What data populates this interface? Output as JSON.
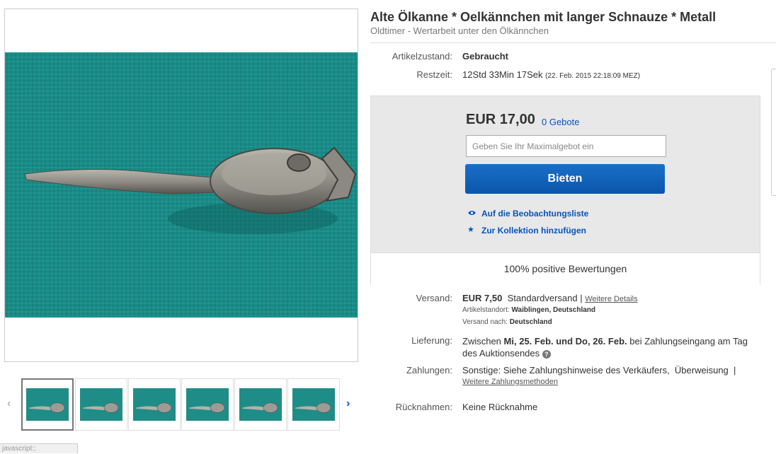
{
  "item": {
    "title": "Alte Ölkanne * Oelkännchen mit langer Schnauze * Metall",
    "subtitle": "Oldtimer - Wertarbeit unter den Ölkännchen"
  },
  "condition": {
    "label": "Artikelzustand:",
    "value": "Gebraucht"
  },
  "time_left": {
    "label": "Restzeit:",
    "value": "12Std 33Min 17Sek",
    "end": "(22. Feb. 2015   22:18:09 MEZ)"
  },
  "bid": {
    "price": "EUR 17,00",
    "bids": "0 Gebote",
    "placeholder": "Geben Sie Ihr Maximalgebot ein",
    "button": "Bieten",
    "watch": "Auf die Beobachtungsliste",
    "collection": "Zur Kollektion hinzufügen",
    "feedback": "100% positive Bewertungen"
  },
  "shipping": {
    "label": "Versand:",
    "price": "EUR 7,50",
    "service": "Standardversand |",
    "details_link": "Weitere Details",
    "location_label": "Artikelstandort:",
    "location": "Waiblingen, Deutschland",
    "ships_to_label": "Versand nach:",
    "ships_to": "Deutschland"
  },
  "delivery": {
    "label": "Lieferung:",
    "prefix": "Zwischen",
    "dates": "Mi, 25. Feb. und Do, 26. Feb.",
    "suffix": "bei Zahlungseingang am Tag",
    "line2": "des Auktionsendes",
    "help": "?"
  },
  "payments": {
    "label": "Zahlungen:",
    "value": "Sonstige: Siehe Zahlungshinweise des Verkäufers,  Überweisung  |",
    "more_link": "Weitere Zahlungsmethoden"
  },
  "returns": {
    "label": "Rücknahmen:",
    "value": "Keine Rücknahme"
  },
  "thumbnails": {
    "count": 6,
    "prev": "‹",
    "next": "›"
  },
  "status_bar": "javascript:;",
  "colors": {
    "link": "#0654ba",
    "button": "#0a56ab",
    "photo_bg": "#1b8a86"
  }
}
